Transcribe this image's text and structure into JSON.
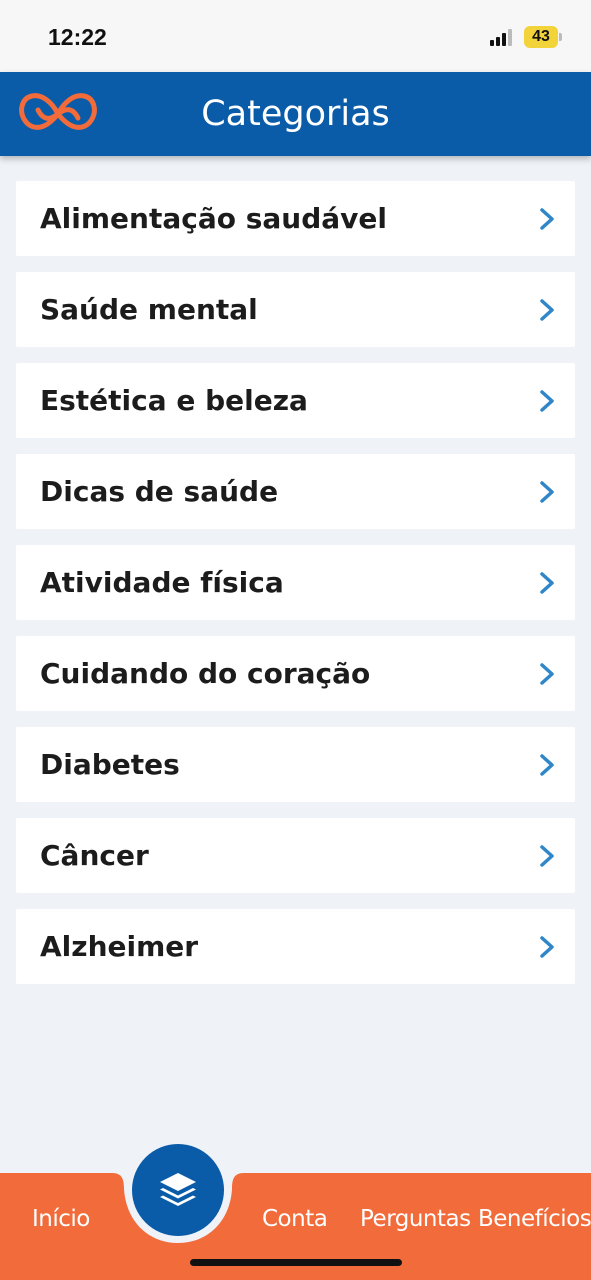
{
  "status_bar": {
    "time": "12:22",
    "battery": "43",
    "battery_color": "#f2d33a"
  },
  "header": {
    "title": "Categorias",
    "logo_icon": "double-heart-logo",
    "background_color": "#0a5ba8",
    "logo_color": "#f26b3a"
  },
  "categories": [
    {
      "label": "Alimentação saudável"
    },
    {
      "label": "Saúde mental"
    },
    {
      "label": "Estética e beleza"
    },
    {
      "label": "Dicas de saúde"
    },
    {
      "label": "Atividade física"
    },
    {
      "label": "Cuidando do coração"
    },
    {
      "label": "Diabetes"
    },
    {
      "label": "Câncer"
    },
    {
      "label": "Alzheimer"
    }
  ],
  "chevron_color": "#2f86c9",
  "bottom_nav": {
    "background_color": "#f26b3a",
    "items": [
      {
        "label": "Início"
      },
      {
        "label": "Conta"
      },
      {
        "label": "Perguntas"
      },
      {
        "label": "Benefícios"
      }
    ],
    "center_button_icon": "layers-icon"
  }
}
